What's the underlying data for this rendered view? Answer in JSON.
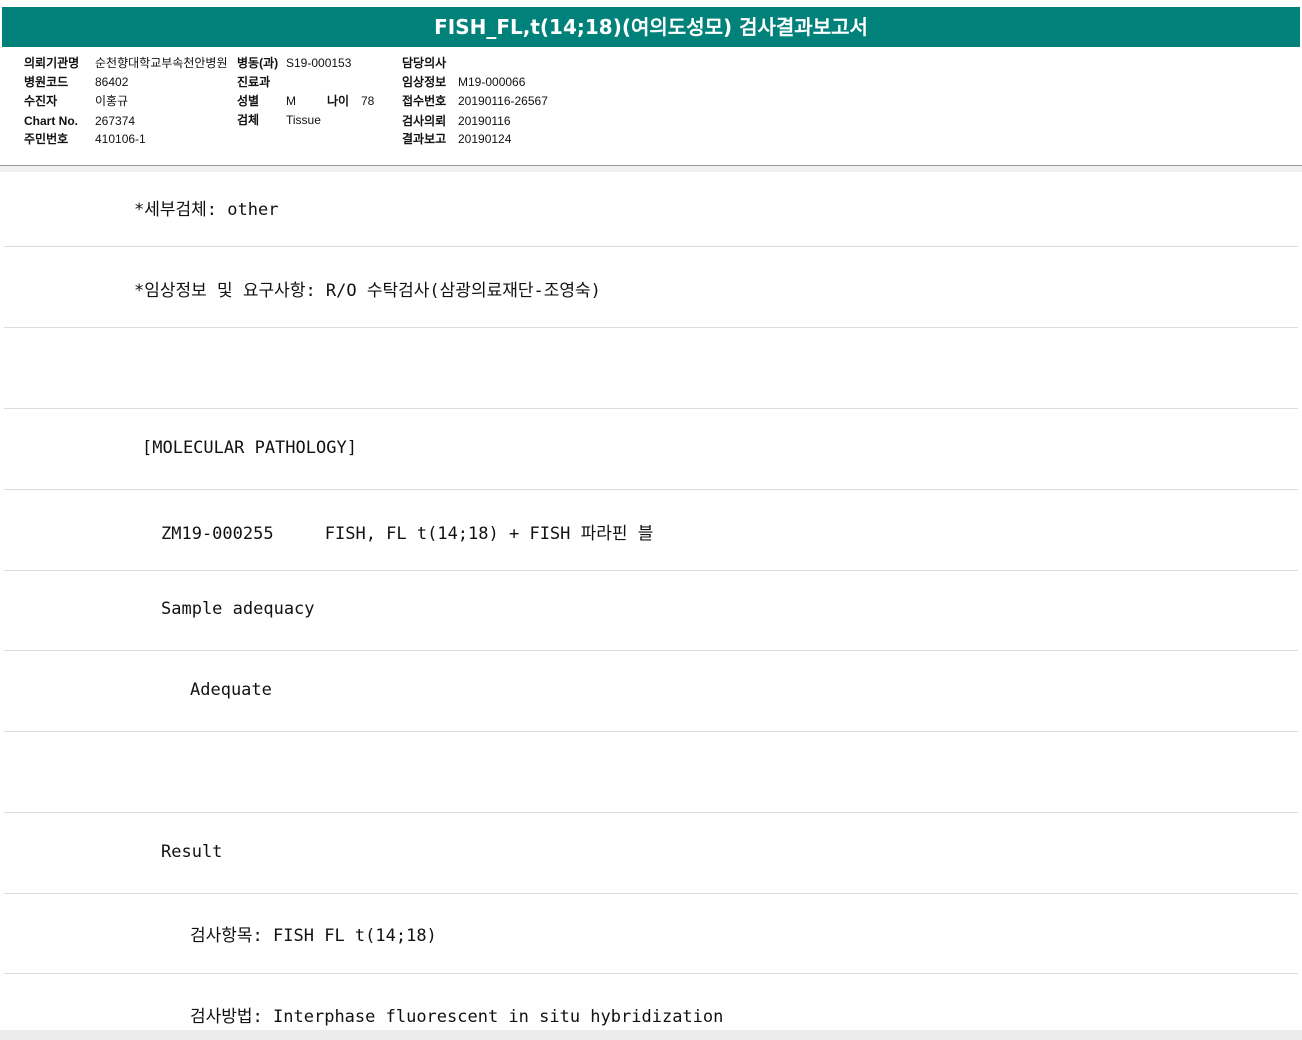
{
  "report": {
    "title": "FISH_FL,t(14;18)(여의도성모) 검사결과보고서"
  },
  "header": {
    "institution_label": "의뢰기관명",
    "institution_value": "순천향대학교부속천안병원",
    "ward_label": "병동(과)",
    "ward_value": "S19-000153",
    "doctor_label": "담당의사",
    "doctor_value": "",
    "hospital_code_label": "병원코드",
    "hospital_code_value": "86402",
    "department_label": "진료과",
    "department_value": "",
    "clinical_info_label": "임상정보",
    "clinical_info_value": "M19-000066",
    "patient_label": "수진자",
    "patient_value": "이홍규",
    "sex_label": "성별",
    "sex_value": "M",
    "age_label": "나이",
    "age_value": "78",
    "receipt_no_label": "접수번호",
    "receipt_no_value": "20190116-26567",
    "chart_label": "Chart No.",
    "chart_value": "267374",
    "specimen_label": "검체",
    "specimen_value": "Tissue",
    "request_date_label": "검사의뢰",
    "request_date_value": "20190116",
    "id_label": "주민번호",
    "id_value": "410106-1",
    "report_date_label": "결과보고",
    "report_date_value": "20190124"
  },
  "lines": [
    "*세부검체: other",
    "*임상정보 및 요구사항: R/O 수탁검사(삼광의료재단-조영숙)",
    "",
    "[MOLECULAR PATHOLOGY]",
    "ZM19-000255     FISH, FL t(14;18) + FISH 파라핀 블",
    "Sample adequacy",
    "Adequate",
    "",
    "Result",
    "검사항목: FISH FL t(14;18)",
    "검사방법: Interphase fluorescent in situ hybridization"
  ]
}
